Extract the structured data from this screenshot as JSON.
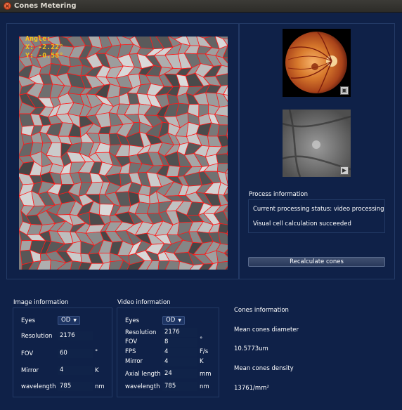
{
  "window": {
    "title": "Cones Metering",
    "close_glyph": "×"
  },
  "overlay": {
    "angle_label": "Angle:",
    "x_text": "X: -2.22°",
    "y_text": "Y: -0.58°"
  },
  "process": {
    "title": "Process information",
    "status": "Current processing status: video processing",
    "result": "Visual cell calculation succeeded"
  },
  "recalc_label": "Recalculate cones",
  "image_info": {
    "title": "Image information",
    "eyes_label": "Eyes",
    "eyes_value": "OD",
    "resolution_label": "Resolution",
    "resolution_value": "2176",
    "fov_label": "FOV",
    "fov_value": "60",
    "fov_unit": "°",
    "mirror_label": "Mirror",
    "mirror_value": "4",
    "mirror_unit": "K",
    "wavelength_label": "wavelength",
    "wavelength_value": "785",
    "wavelength_unit": "nm"
  },
  "video_info": {
    "title": "Video information",
    "eyes_label": "Eyes",
    "eyes_value": "OD",
    "resolution_label": "Resolution",
    "resolution_value": "2176",
    "fov_label": "FOV",
    "fov_value": "8",
    "fov_unit": "°",
    "fps_label": "FPS",
    "fps_value": "4",
    "fps_unit": "F/s",
    "mirror_label": "Mirror",
    "mirror_value": "4",
    "mirror_unit": "K",
    "axial_label": "Axial length",
    "axial_value": "24",
    "axial_unit": "mm",
    "wavelength_label": "wavelength",
    "wavelength_value": "785",
    "wavelength_unit": "nm"
  },
  "cones": {
    "title": "Cones information",
    "diameter_label": "Mean cones diameter",
    "diameter_value": "10.5773um",
    "density_label": "Mean cones density",
    "density_value": "13761/mm²"
  },
  "icons": {
    "fundus_button": "image-icon",
    "ir_button": "play-icon",
    "dropdown_arrow": "▼"
  },
  "colors": {
    "background": "#0f2148",
    "cell_outline": "#ff1a1a",
    "overlay_text": "#f4c21b"
  }
}
